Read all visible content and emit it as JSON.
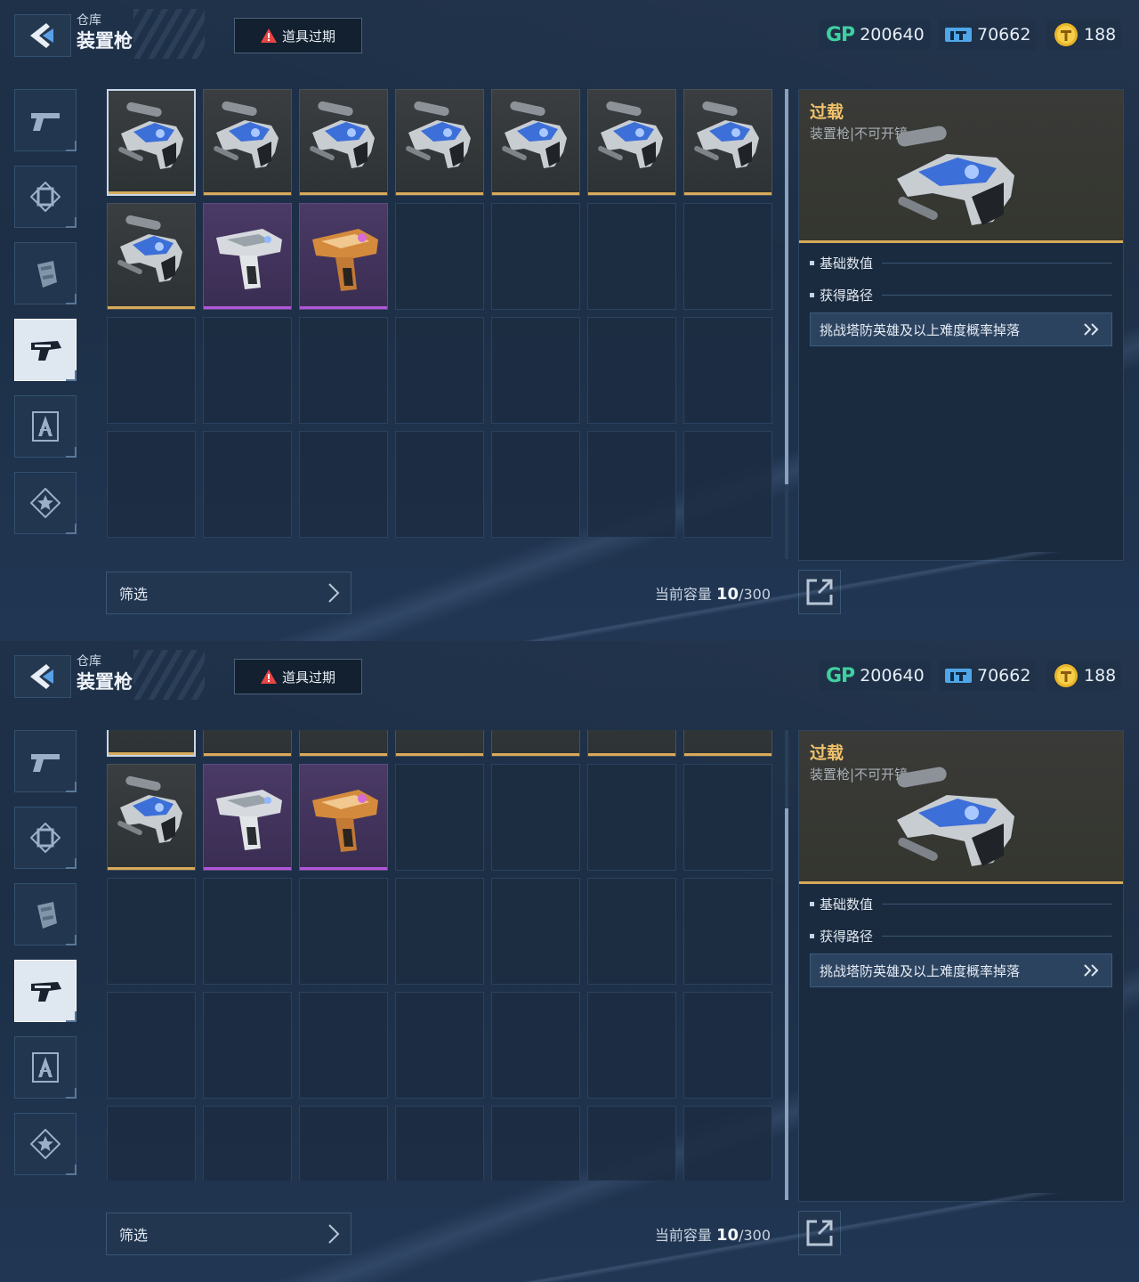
{
  "header": {
    "breadcrumb": "仓库",
    "title": "装置枪",
    "expired_button_label": "道具过期"
  },
  "currencies": [
    {
      "icon": "gp-icon",
      "label": "GP",
      "value": "200640"
    },
    {
      "icon": "ticket-icon",
      "value": "70662"
    },
    {
      "icon": "gold-coin-icon",
      "value": "188"
    }
  ],
  "rail": {
    "items": [
      {
        "icon": "pistol-icon",
        "active": false
      },
      {
        "icon": "armor-frame-icon",
        "active": false
      },
      {
        "icon": "grenade-icon",
        "active": false
      },
      {
        "icon": "device-gun-icon",
        "active": true
      },
      {
        "icon": "compass-tool-icon",
        "active": false
      },
      {
        "icon": "star-badge-icon",
        "active": false
      }
    ]
  },
  "inventory": {
    "items": [
      {
        "rarity": "gold",
        "kind": "overload"
      },
      {
        "rarity": "gold",
        "kind": "overload"
      },
      {
        "rarity": "gold",
        "kind": "overload"
      },
      {
        "rarity": "gold",
        "kind": "overload"
      },
      {
        "rarity": "gold",
        "kind": "overload"
      },
      {
        "rarity": "gold",
        "kind": "overload"
      },
      {
        "rarity": "gold",
        "kind": "overload"
      },
      {
        "rarity": "gold",
        "kind": "overload"
      },
      {
        "rarity": "purple",
        "kind": "white-device"
      },
      {
        "rarity": "purple",
        "kind": "orange-device"
      }
    ],
    "capacity_label": "当前容量",
    "capacity_used": "10",
    "capacity_total": "/300"
  },
  "detail": {
    "name": "过载",
    "type": "装置枪|不可开镜",
    "section_base": "基础数值",
    "section_source": "获得路径",
    "source_text": "挑战塔防英雄及以上难度概率掉落"
  },
  "filter": {
    "label": "筛选"
  },
  "colors": {
    "gold": "#d8aa5a",
    "purple": "#b056d8",
    "gp_green": "#3fd0a0",
    "item_name": "#f0c26a"
  }
}
